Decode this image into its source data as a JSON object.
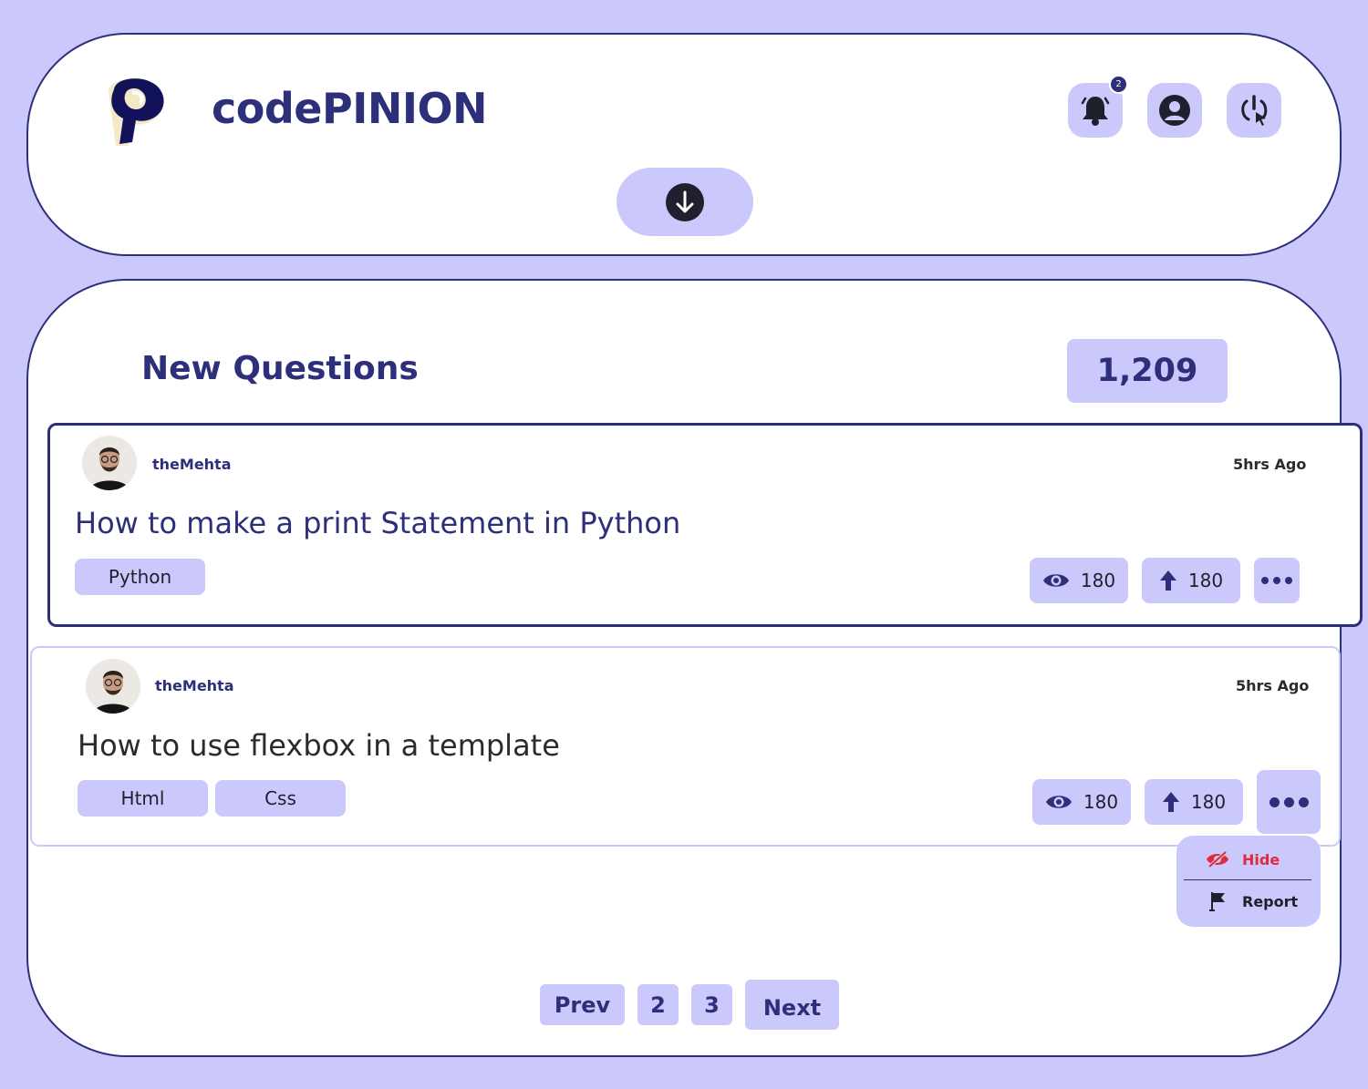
{
  "header": {
    "brand": "codePINION",
    "notifications": {
      "count": "2"
    },
    "icons": [
      "logo-icon",
      "bell-icon",
      "user-icon",
      "logout-icon",
      "arrow-down-icon"
    ]
  },
  "feed": {
    "title": "New Questions",
    "total": "1,209",
    "questions": [
      {
        "author": "theMehta",
        "time": "5hrs Ago",
        "title": "How to make a print Statement in Python",
        "tags": [
          "Python"
        ],
        "views": "180",
        "upvotes": "180"
      },
      {
        "author": "theMehta",
        "time": "5hrs Ago",
        "title": "How to use flexbox in a template",
        "tags": [
          "Html",
          "Css"
        ],
        "views": "180",
        "upvotes": "180"
      }
    ],
    "menu": {
      "hide": "Hide",
      "report": "Report"
    }
  },
  "pagination": {
    "prev": "Prev",
    "pages": [
      "2",
      "3"
    ],
    "next": "Next"
  },
  "colors": {
    "accent": "#2e2f7a",
    "light": "#cbc9fb",
    "danger": "#e02b3a"
  }
}
